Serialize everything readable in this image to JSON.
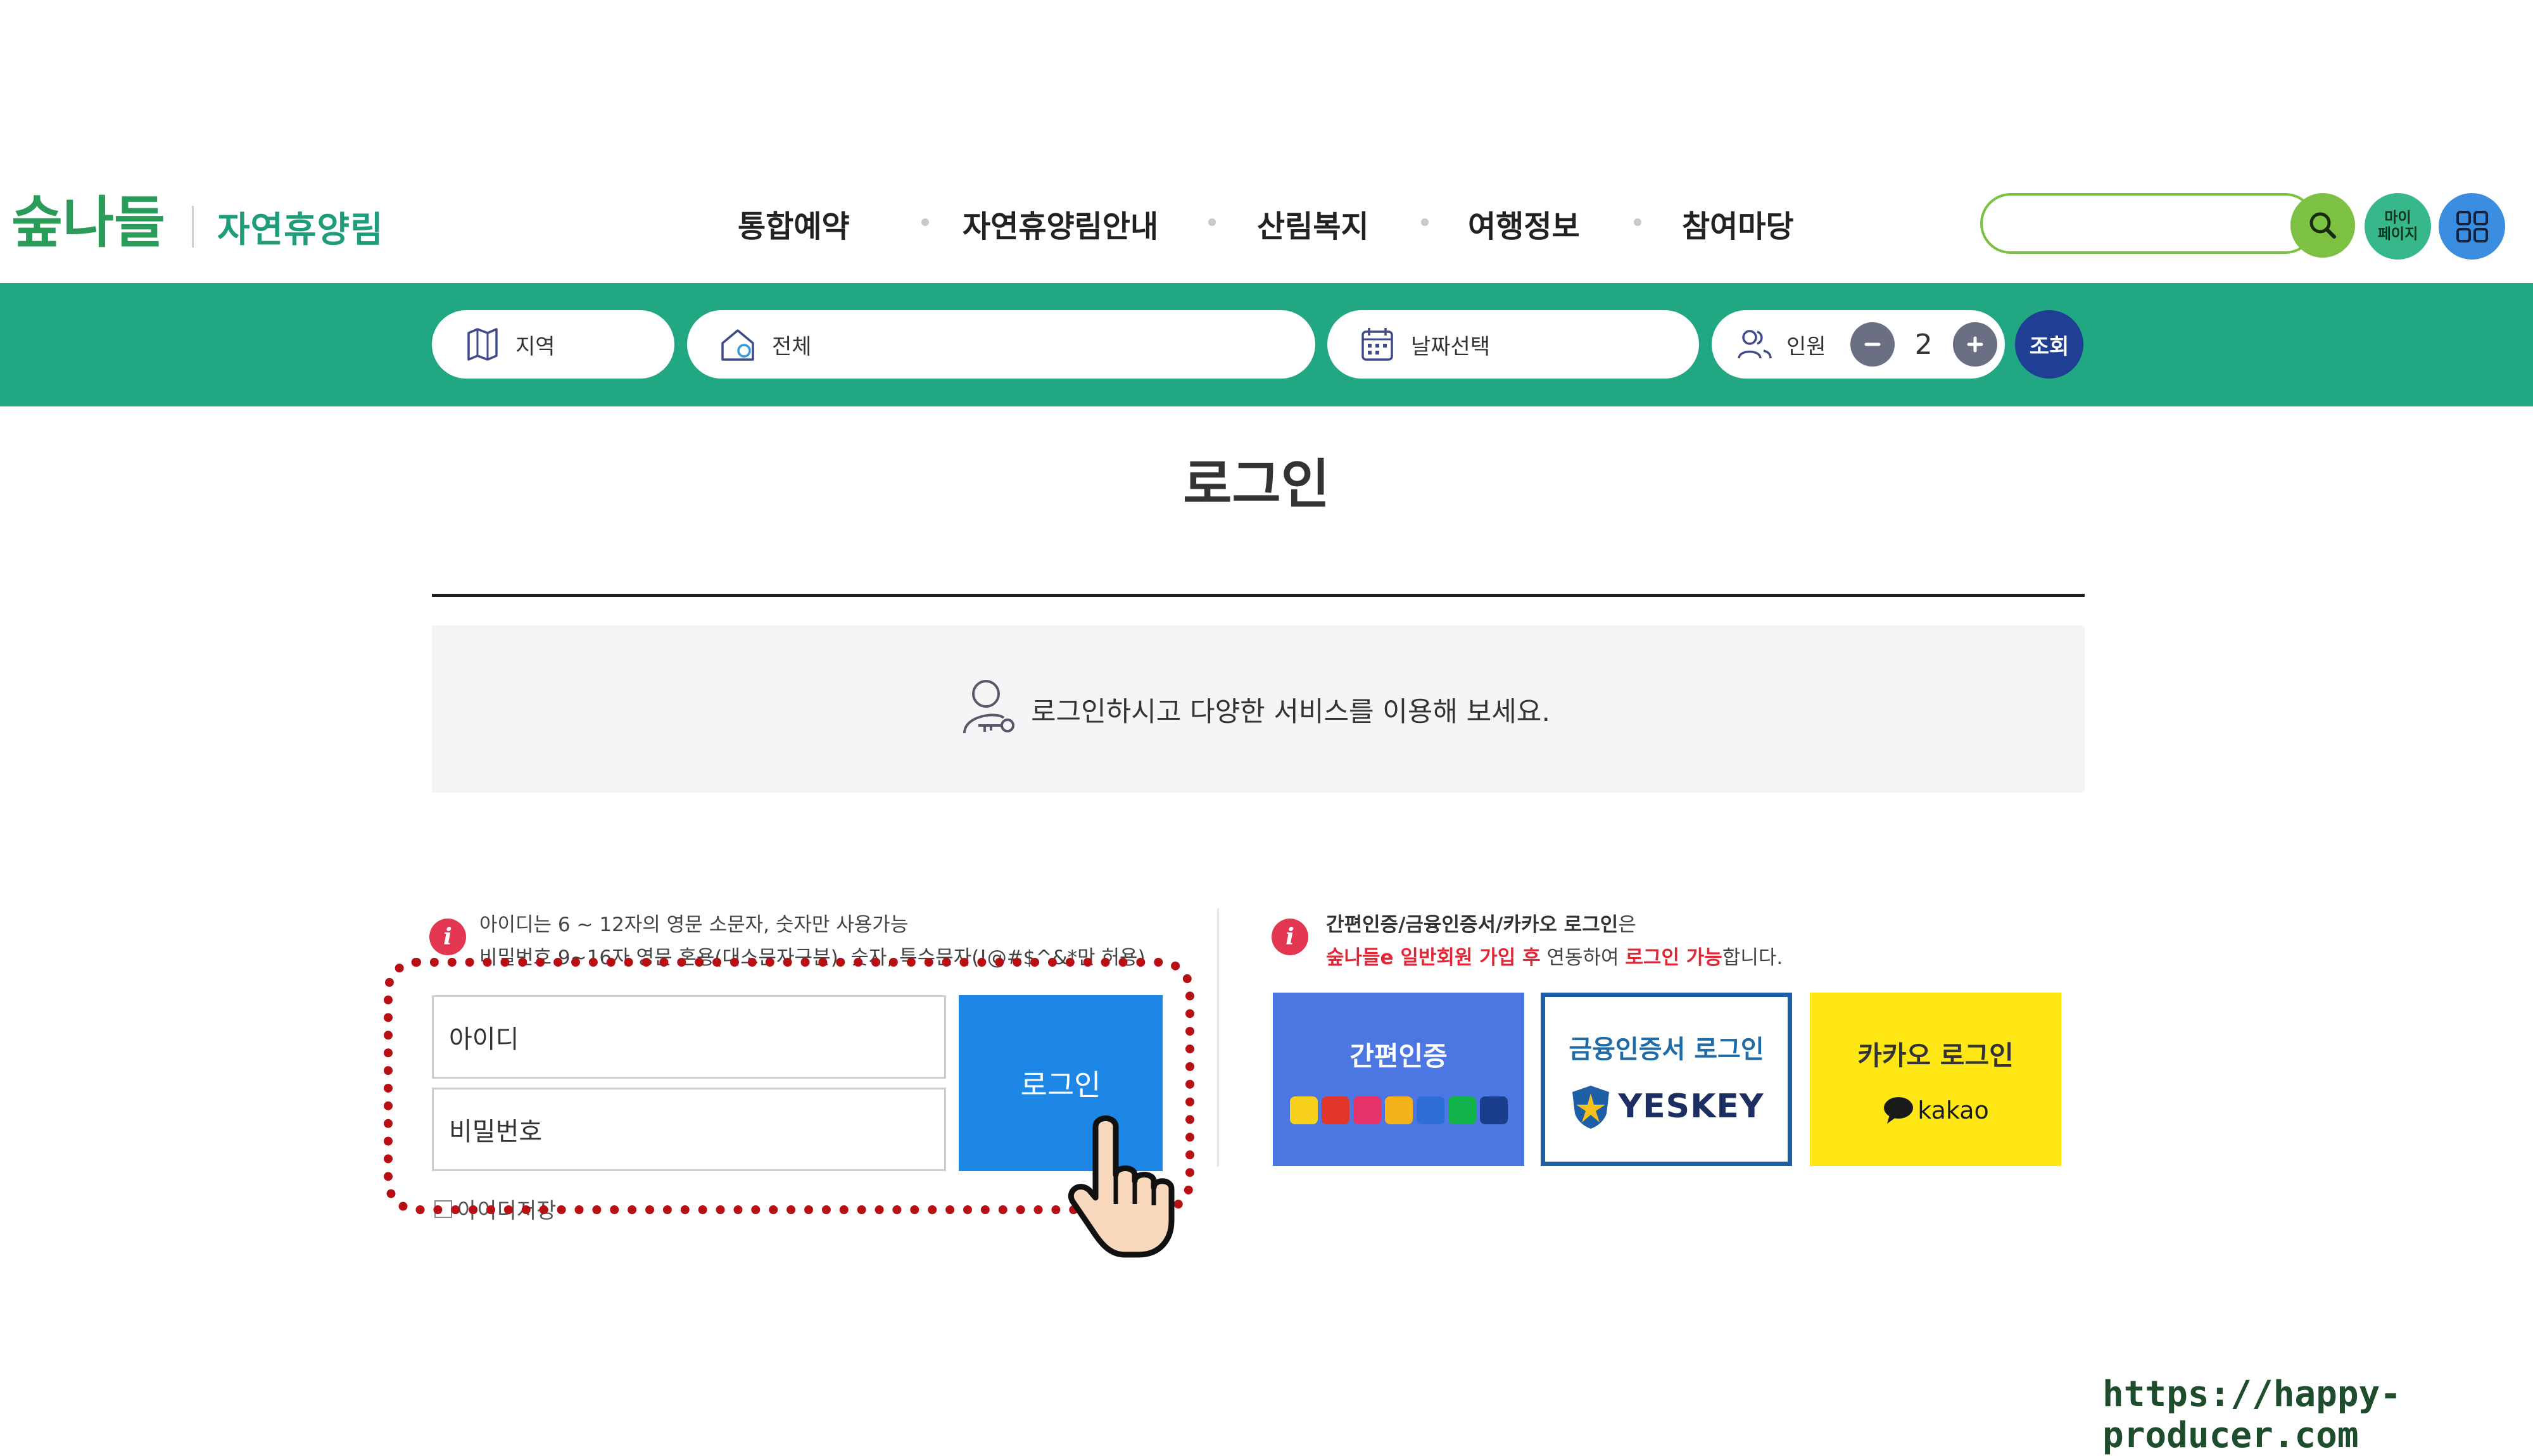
{
  "header": {
    "logo_text": "숲나들e",
    "logo_sub": "자연휴양림",
    "nav": [
      {
        "label": "통합예약"
      },
      {
        "label": "자연휴양림안내"
      },
      {
        "label": "산림복지"
      },
      {
        "label": "여행정보"
      },
      {
        "label": "참여마당"
      }
    ],
    "search_value": "",
    "mypage_label_1": "마이",
    "mypage_label_2": "페이지"
  },
  "searchbar": {
    "region_label": "지역",
    "facility_label": "전체",
    "date_label": "날짜선택",
    "people_label": "인원",
    "people_count": "2",
    "submit_label": "조회"
  },
  "page": {
    "title": "로그인",
    "info_message": "로그인하시고 다양한 서비스를 이용해 보세요."
  },
  "login_form": {
    "notice_line1": "아이디는 6 ~ 12자의 영문 소문자, 숫자만 사용가능",
    "notice_line2": "비밀번호 9~16자 영문 혼용(대소문자구분), 숫자, 특수문자(!@#$^&*만 허용)",
    "id_placeholder": "아이디",
    "password_placeholder": "비밀번호",
    "login_button": "로그인",
    "remember_label": "아이디저장"
  },
  "alt_login": {
    "notice_a": "간편인증/금융인증서/카카오 로그인",
    "notice_b": "은",
    "notice_c": "숲나들e 일반회원 가입 후",
    "notice_d": " 연동하여 ",
    "notice_e": "로그인 가능",
    "notice_f": "합니다.",
    "simple_auth": "간편인증",
    "cert_login": "금융인증서 로그인",
    "cert_brand": "YESKEY",
    "kakao_login": "카카오 로그인",
    "kakao_brand": "kakao"
  },
  "watermark": "https://happy-producer.com",
  "colors": {
    "brand_green": "#22a783",
    "search_green": "#7cc142",
    "login_blue": "#1e87e5",
    "simple_auth_blue": "#4c76e1",
    "cert_blue": "#1f5fa8",
    "kakao_yellow": "#ffe716",
    "highlight_red": "#b80f14"
  },
  "icons": [
    "search-icon",
    "grid-menu-icon",
    "map-icon",
    "home-pin-icon",
    "calendar-icon",
    "people-icon",
    "minus-icon",
    "plus-icon",
    "user-key-icon",
    "info-icon",
    "pointer-hand-icon",
    "kakao-bubble-icon"
  ]
}
